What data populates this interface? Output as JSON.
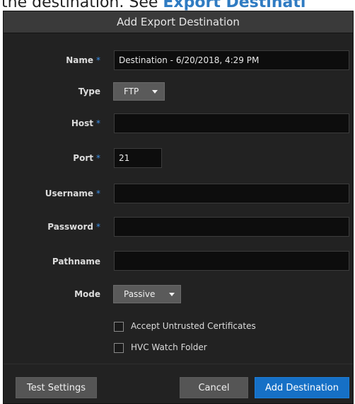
{
  "doc": {
    "text_before": "the destination. See ",
    "link_text": "Export Destinati"
  },
  "dialog": {
    "title": "Add Export Destination",
    "fields": {
      "name": {
        "label": "Name",
        "required_mark": "*",
        "value": "Destination - 6/20/2018, 4:29 PM"
      },
      "type": {
        "label": "Type",
        "selected": "FTP"
      },
      "host": {
        "label": "Host",
        "required_mark": "*",
        "value": ""
      },
      "port": {
        "label": "Port",
        "required_mark": "*",
        "value": "21"
      },
      "username": {
        "label": "Username",
        "required_mark": "*",
        "value": ""
      },
      "password": {
        "label": "Password",
        "required_mark": "*",
        "value": ""
      },
      "pathname": {
        "label": "Pathname",
        "value": ""
      },
      "mode": {
        "label": "Mode",
        "selected": "Passive"
      }
    },
    "checkboxes": [
      {
        "label": "Accept Untrusted Certificates",
        "checked": false
      },
      {
        "label": "HVC Watch Folder",
        "checked": false
      }
    ],
    "buttons": {
      "test_settings": "Test Settings",
      "cancel": "Cancel",
      "add_destination": "Add Destination"
    }
  },
  "colors": {
    "dialog_bg": "#222222",
    "header_bg": "#3a3a3a",
    "input_bg": "#0d0d0d",
    "required_accent": "#3a8ee6",
    "primary_button": "#1670c6",
    "doc_link": "#2f7bc2"
  }
}
